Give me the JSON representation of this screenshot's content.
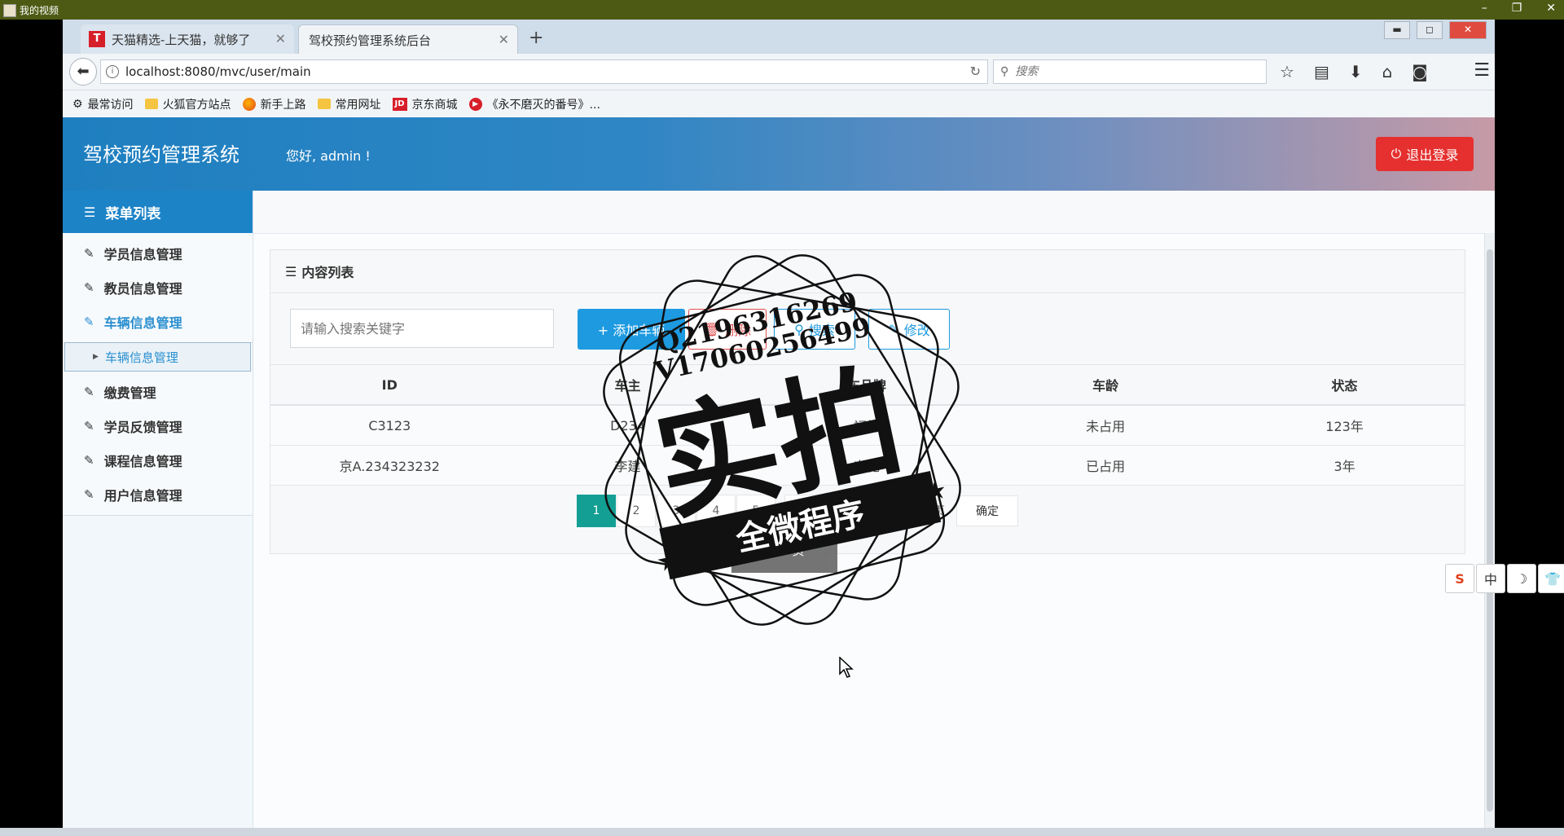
{
  "player": {
    "title": "我的视频",
    "controls": [
      "–",
      "❐",
      "✕"
    ]
  },
  "browser": {
    "tabs": [
      {
        "label": "天猫精选-上天猫，就够了",
        "favicon": "T"
      },
      {
        "label": "驾校预约管理系统后台"
      }
    ],
    "new_tab": "+",
    "url": "localhost:8080/mvc/user/main",
    "search_placeholder": "搜索",
    "bookmarks": [
      {
        "label": "最常访问",
        "icon": "gear-icon"
      },
      {
        "label": "火狐官方站点",
        "icon": "folder-icon"
      },
      {
        "label": "新手上路",
        "icon": "firefox-icon"
      },
      {
        "label": "常用网址",
        "icon": "folder-icon"
      },
      {
        "label": "京东商城",
        "icon": "jd-icon"
      },
      {
        "label": "《永不磨灭的番号》...",
        "icon": "video-icon"
      }
    ],
    "jd_mark": "JD"
  },
  "app": {
    "title": "驾校预约管理系统",
    "greeting": "您好, admin !",
    "logout_label": "退出登录",
    "menu_header": "菜单列表",
    "menu": [
      "学员信息管理",
      "教员信息管理",
      "车辆信息管理",
      "缴费管理",
      "学员反馈管理",
      "课程信息管理",
      "用户信息管理"
    ],
    "active_menu": "车辆信息管理",
    "submenu_item": "车辆信息管理",
    "panel_title": "内容列表",
    "search_placeholder": "请输入搜索关键字",
    "buttons": {
      "add": "+ 添加车辆",
      "delete": "删除",
      "search": "搜索",
      "edit": "修改"
    },
    "table": {
      "headers": [
        "ID",
        "车主",
        "车品牌",
        "车龄",
        "状态"
      ],
      "rows": [
        [
          "C3123",
          "D234",
          "福特",
          "未占用",
          "123年"
        ],
        [
          "京A.234323232",
          "李建",
          "奔驰",
          "已占用",
          "3年"
        ]
      ]
    },
    "pager": {
      "pages": [
        "1",
        "2",
        "3",
        "4",
        "5"
      ],
      "current": "1",
      "next": "下一页",
      "goto": "到第",
      "input_value": "1",
      "unit": "页",
      "confirm": "确定",
      "info": "第 1 页"
    }
  },
  "watermark": {
    "line1": "Q2196316269",
    "line2": "V17060256499",
    "big": "实拍",
    "banner": "全微程序"
  },
  "widget": [
    "S",
    "中",
    "☽",
    "👕"
  ]
}
